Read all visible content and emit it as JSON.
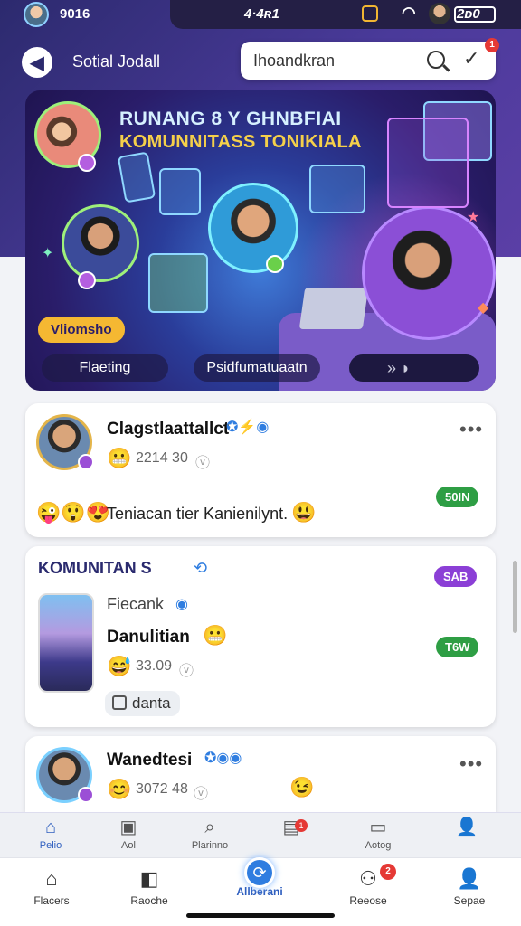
{
  "status_bar": {
    "left_text": "9016",
    "center_text": "4·4ʀ1",
    "right_text": "2ᴅ0"
  },
  "header": {
    "title": "Sotial Jodall",
    "search_text": "Ihoandkran",
    "notification_count": "1"
  },
  "banner": {
    "title_line1": "RUNANG 8 Y GHNBFIAI",
    "title_line2": "KOMUNNITASS TONIKIALA",
    "tag_label": "Vliomsho",
    "nav_left": "Flaeting",
    "nav_mid": "Psidfumatuaatn",
    "nav_arrow": "»  ◗"
  },
  "posts": [
    {
      "name": "Clagstlaattallct",
      "meta": "2214 30",
      "pill": "50IN",
      "pill_color": "#2e9e44",
      "text": "Teniacan tier Kanienilynt."
    },
    {
      "section_title": "KOMUNITAN S",
      "section_pill": "SAB",
      "section_pill_color": "#8b3fd6",
      "subtitle": "Fiecank",
      "name": "Danulitian",
      "meta": "33.09",
      "pill": "T6W",
      "pill_color": "#2e9e44",
      "chip": "danta"
    },
    {
      "name": "Wanedtesi",
      "meta": "3072 48"
    }
  ],
  "tabbar_top": [
    {
      "label": "Pelio",
      "icon": "home-icon",
      "active": true
    },
    {
      "label": "Aol",
      "icon": "calendar-icon"
    },
    {
      "label": "Plarinno",
      "icon": "search-icon"
    },
    {
      "label": "",
      "icon": "media-icon",
      "badge": "1"
    },
    {
      "label": "Aotog",
      "icon": "chat-icon"
    },
    {
      "label": "",
      "icon": "profile-icon"
    }
  ],
  "tabbar_bottom": [
    {
      "label": "Flacers",
      "icon": "home-icon"
    },
    {
      "label": "Raoche",
      "icon": "bookmark-icon"
    },
    {
      "label": "Allberani",
      "icon": "sync-icon",
      "active": true
    },
    {
      "label": "Reeose",
      "icon": "people-icon",
      "badge": "2"
    },
    {
      "label": "Sepae",
      "icon": "profile-icon"
    }
  ]
}
